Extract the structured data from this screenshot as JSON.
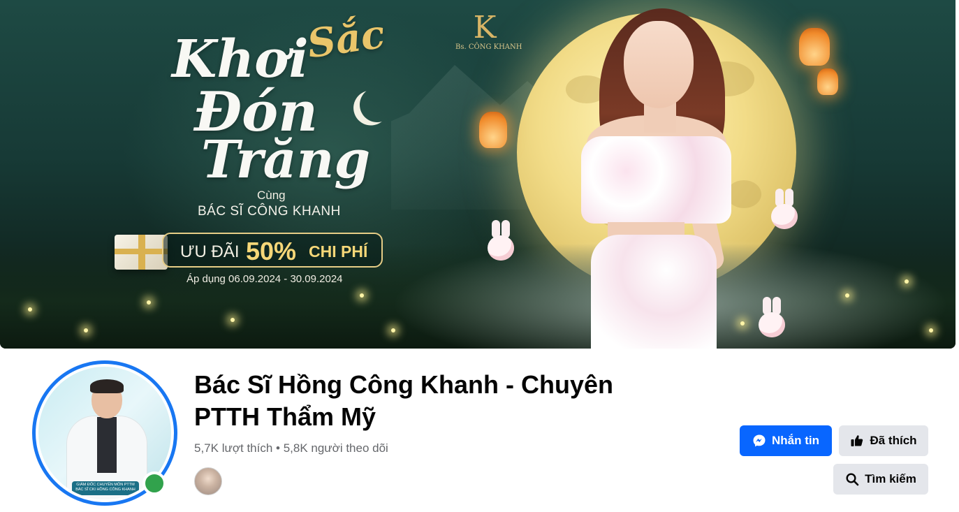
{
  "cover": {
    "logo_letter": "K",
    "logo_name": "Bs. CÔNG KHANH",
    "headline_1": "Khơi",
    "headline_2": "Sắc",
    "headline_3": "Đón",
    "headline_4": "Trăng",
    "with_text": "Cùng",
    "doctor_text": "BÁC SĨ CÔNG KHANH",
    "promo_prefix": "ƯU ĐÃI",
    "promo_percent": "50%",
    "promo_suffix": "CHI PHÍ",
    "apply_dates": "Áp dụng 06.09.2024 - 30.09.2024"
  },
  "profile": {
    "avatar_banner_line1": "GIÁM ĐỐC CHUYÊN MÔN PTTM",
    "avatar_banner_line2": "BÁC SĨ CKI HỒNG CÔNG KHANH",
    "page_name": "Bác Sĩ Hồng Công Khanh - Chuyên PTTH Thẩm Mỹ",
    "stats": "5,7K lượt thích • 5,8K người theo dõi",
    "online": true
  },
  "actions": {
    "message_label": "Nhắn tin",
    "liked_label": "Đã thích",
    "search_label": "Tìm kiếm"
  },
  "colors": {
    "primary_button": "#0866ff",
    "secondary_button": "#e4e6eb",
    "online_status": "#31a24c",
    "avatar_ring": "#1877f2"
  },
  "icons": {
    "message": "messenger-icon",
    "liked": "thumbs-up-icon",
    "search": "search-icon"
  }
}
